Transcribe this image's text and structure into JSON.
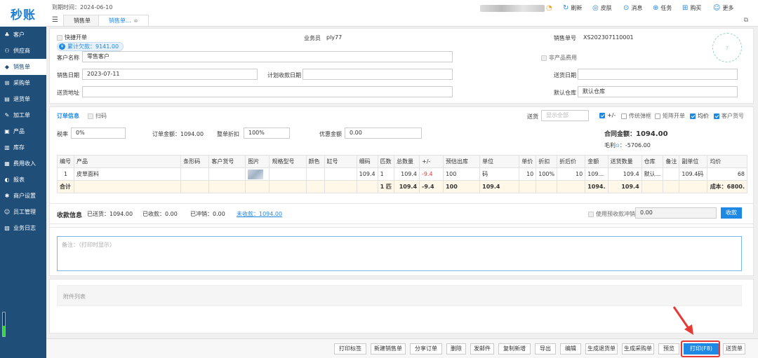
{
  "app": {
    "logo": "秒账",
    "expiry": "到期时间：2024-06-10"
  },
  "tabs": [
    {
      "label": "销售单"
    },
    {
      "label": "销售单..."
    }
  ],
  "toolbar": {
    "refresh": "刷新",
    "skin": "皮肤",
    "message": "消息",
    "task": "任务",
    "buy": "购买",
    "more": "更多"
  },
  "sidebar": {
    "items": [
      {
        "label": "客户",
        "icon": "people-icon"
      },
      {
        "label": "供应商",
        "icon": "network-icon"
      },
      {
        "label": "销售单",
        "icon": "tag-icon"
      },
      {
        "label": "采购单",
        "icon": "cart-icon"
      },
      {
        "label": "退货单",
        "icon": "return-icon"
      },
      {
        "label": "加工单",
        "icon": "wrench-icon"
      },
      {
        "label": "产品",
        "icon": "box-icon"
      },
      {
        "label": "库存",
        "icon": "warehouse-icon"
      },
      {
        "label": "费用收入",
        "icon": "money-icon"
      },
      {
        "label": "报表",
        "icon": "chart-icon"
      },
      {
        "label": "商户设置",
        "icon": "gear-icon"
      },
      {
        "label": "员工管理",
        "icon": "user-icon"
      },
      {
        "label": "业务日志",
        "icon": "log-icon"
      }
    ],
    "battery_level": 0.45
  },
  "header": {
    "quick_order": "快捷开单",
    "debt": "累计欠款：9141.00",
    "salesman_label": "业务员",
    "salesman_value": "ply77",
    "order_no_label": "销售单号",
    "order_no_value": "XS202307110001",
    "customer_label": "客户名称",
    "customer_value": "零售客户",
    "nonproduct_fee": "非产品费用",
    "date_label": "销售日期",
    "date_value": "2023-07-11",
    "plan_date_label": "计划收款日期",
    "delivery_date_label": "送货日期",
    "address_label": "送货地址",
    "warehouse_label": "默认仓库",
    "warehouse_value": "默认仓库"
  },
  "order": {
    "title": "订单信息",
    "scan": "扫码",
    "delivery_label": "送货",
    "delivery_placeholder": "显示全部",
    "opt_plusminus": "+/-",
    "opt_traditional": "传统弹框",
    "opt_matrix": "矩阵开单",
    "opt_avgprice": "均价",
    "opt_custno": "客户货号",
    "tax_label": "税率",
    "tax_value": "0%",
    "amount_label": "订单金额：1094.00",
    "discount_label": "整单折扣",
    "discount_value": "100%",
    "promo_label": "优惠金额",
    "promo_value": "0.00",
    "contract_label": "合同金额：",
    "contract_value": "1094.00",
    "profit_label": "毛利",
    "profit_value": "：-5706.00"
  },
  "table": {
    "headers": [
      "编号",
      "产品",
      "条形码",
      "客户货号",
      "图片",
      "规格型号",
      "颜色",
      "缸号",
      "细码",
      "匹数",
      "总数量",
      "+/-",
      "预估出库",
      "单位",
      "单价",
      "折扣",
      "折后价",
      "金额",
      "送货数量",
      "仓库",
      "备注",
      "副单位",
      "均价"
    ],
    "row": [
      "1",
      "皮草面料",
      "",
      "",
      "",
      "",
      "",
      "",
      "109.4",
      "1",
      "109.4",
      "-9.4",
      "100",
      "码",
      "10",
      "100%",
      "10",
      "109...",
      "109.4",
      "默认...",
      "",
      "109.4码",
      "68"
    ],
    "footer": [
      "合计",
      "",
      "",
      "",
      "",
      "",
      "",
      "",
      "",
      "1 匹",
      "109.4",
      "-9.4",
      "100",
      "109.4",
      "",
      "",
      "",
      "1094.",
      "109.4",
      "",
      "",
      "",
      "成本：6800."
    ]
  },
  "payment": {
    "title": "收款信息",
    "delivered": "已送货：1094.00",
    "received": "已收款：0.00",
    "offset": "已冲销：0.00",
    "unpaid": "未收款：1094.00",
    "prepay_label": "使用预收款冲销",
    "prepay_value": "0.00",
    "collect_btn": "收款"
  },
  "remark": {
    "placeholder": "备注：（打印时显示）"
  },
  "attach": {
    "label": "附件列表"
  },
  "actions": [
    "打印标签",
    "新建销售单",
    "分享订单",
    "删除",
    "发邮件",
    "复制新增",
    "导出",
    "编辑",
    "生成退货单",
    "生成采购单",
    "预览",
    "打印(F8)",
    "送货单"
  ]
}
